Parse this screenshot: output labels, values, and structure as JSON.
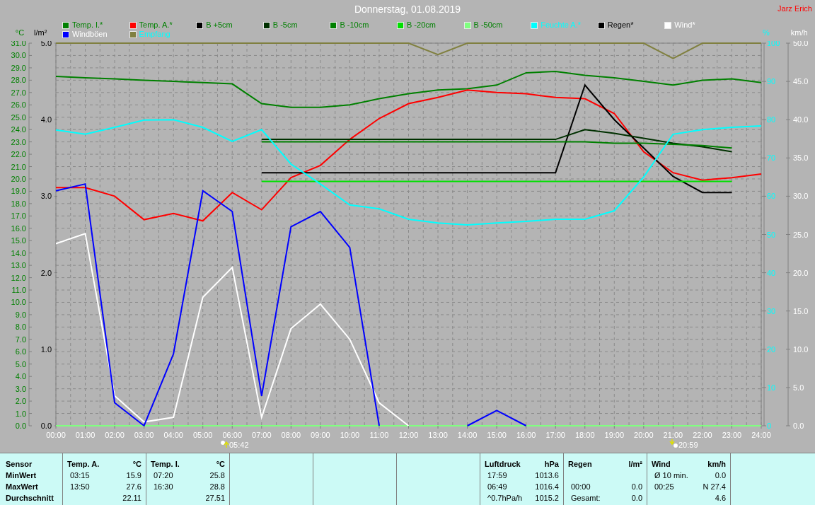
{
  "chart": {
    "author": "Jarz Erich",
    "axis_units": [
      {
        "unit": "°C",
        "color": "#008000"
      },
      {
        "unit": "l/m²",
        "color": "#000000"
      },
      {
        "unit": "%",
        "color": "#00ffff"
      },
      {
        "unit": "km/h",
        "color": "#ffffff"
      }
    ],
    "rain_ticks": [
      "5.0",
      "4.0",
      "3.0",
      "2.0",
      "1.0",
      "0.0"
    ],
    "sunrise": "05:42",
    "sunset": "20:59",
    "chart_data": {
      "type": "line",
      "title": "Donnerstag, 01.08.2019",
      "x": [
        0,
        1,
        2,
        3,
        4,
        5,
        6,
        7,
        8,
        9,
        10,
        11,
        12,
        13,
        14,
        15,
        16,
        17,
        18,
        19,
        20,
        21,
        22,
        23,
        24
      ],
      "xlim": [
        0,
        24
      ],
      "ylim": [
        0,
        31
      ],
      "grid": true,
      "y2lim": [
        0,
        50
      ],
      "y3lim": [
        0,
        100
      ],
      "xticks": [
        {
          "value": 0,
          "label": "00:00"
        },
        {
          "value": 1,
          "label": "01:00"
        },
        {
          "value": 2,
          "label": "02:00"
        },
        {
          "value": 3,
          "label": "03:00"
        },
        {
          "value": 4,
          "label": "04:00"
        },
        {
          "value": 5,
          "label": "05:00"
        },
        {
          "value": 6,
          "label": "06:00"
        },
        {
          "value": 7,
          "label": "07:00"
        },
        {
          "value": 8,
          "label": "08:00"
        },
        {
          "value": 9,
          "label": "09:00"
        },
        {
          "value": 10,
          "label": "10:00"
        },
        {
          "value": 11,
          "label": "11:00"
        },
        {
          "value": 12,
          "label": "12:00"
        },
        {
          "value": 13,
          "label": "13:00"
        },
        {
          "value": 14,
          "label": "14:00"
        },
        {
          "value": 15,
          "label": "15:00"
        },
        {
          "value": 16,
          "label": "16:00"
        },
        {
          "value": 17,
          "label": "17:00"
        },
        {
          "value": 18,
          "label": "18:00"
        },
        {
          "value": 19,
          "label": "19:00"
        },
        {
          "value": 20,
          "label": "20:00"
        },
        {
          "value": 21,
          "label": "21:00"
        },
        {
          "value": 22,
          "label": "22:00"
        },
        {
          "value": 23,
          "label": "23:00"
        },
        {
          "value": 24,
          "label": "24:00"
        }
      ],
      "yticks": [
        {
          "value": 31,
          "label": "31.0"
        },
        {
          "value": 30,
          "label": "30.0"
        },
        {
          "value": 29,
          "label": "29.0"
        },
        {
          "value": 28,
          "label": "28.0"
        },
        {
          "value": 27,
          "label": "27.0"
        },
        {
          "value": 26,
          "label": "26.0"
        },
        {
          "value": 25,
          "label": "25.0"
        },
        {
          "value": 24,
          "label": "24.0"
        },
        {
          "value": 23,
          "label": "23.0"
        },
        {
          "value": 22,
          "label": "22.0"
        },
        {
          "value": 21,
          "label": "21.0"
        },
        {
          "value": 20,
          "label": "20.0"
        },
        {
          "value": 19,
          "label": "19.0"
        },
        {
          "value": 18,
          "label": "18.0"
        },
        {
          "value": 17,
          "label": "17.0"
        },
        {
          "value": 16,
          "label": "16.0"
        },
        {
          "value": 15,
          "label": "15.0"
        },
        {
          "value": 14,
          "label": "14.0"
        },
        {
          "value": 13,
          "label": "13.0"
        },
        {
          "value": 12,
          "label": "12.0"
        },
        {
          "value": 11,
          "label": "11.0"
        },
        {
          "value": 10,
          "label": "10.0"
        },
        {
          "value": 9,
          "label": "9.0"
        },
        {
          "value": 8,
          "label": "8.0"
        },
        {
          "value": 7,
          "label": "7.0"
        },
        {
          "value": 6,
          "label": "6.0"
        },
        {
          "value": 5,
          "label": "5.0"
        },
        {
          "value": 4,
          "label": "4.0"
        },
        {
          "value": 3,
          "label": "3.0"
        },
        {
          "value": 2,
          "label": "2.0"
        },
        {
          "value": 1,
          "label": "1.0"
        },
        {
          "value": 0,
          "label": "0.0"
        }
      ],
      "y3ticks": [
        100,
        90,
        80,
        70,
        60,
        50,
        40,
        30,
        20,
        10,
        0
      ],
      "y2ticks": [
        {
          "value": 50,
          "label": "50.0"
        },
        {
          "value": 45,
          "label": "45.0"
        },
        {
          "value": 40,
          "label": "40.0"
        },
        {
          "value": 35,
          "label": "35.0"
        },
        {
          "value": 30,
          "label": "30.0"
        },
        {
          "value": 25,
          "label": "25.0"
        },
        {
          "value": 20,
          "label": "20.0"
        },
        {
          "value": 15,
          "label": "15.0"
        },
        {
          "value": 10,
          "label": "10.0"
        },
        {
          "value": 5,
          "label": "5.0"
        },
        {
          "value": 0,
          "label": "0.0"
        }
      ],
      "series": [
        {
          "name": "Temp. I.*",
          "color": "#008000",
          "values": [
            28.3,
            28.2,
            28.1,
            28.0,
            27.9,
            27.8,
            27.7,
            26.1,
            25.8,
            25.8,
            26.0,
            26.5,
            26.9,
            27.2,
            27.3,
            27.6,
            28.6,
            28.7,
            28.4,
            28.2,
            27.9,
            27.6,
            28.0,
            28.1,
            27.8
          ]
        },
        {
          "name": "Temp. A.*",
          "color": "#ff0000",
          "values": [
            19.3,
            19.3,
            18.6,
            16.7,
            17.2,
            16.6,
            18.9,
            17.5,
            20.1,
            21.1,
            23.2,
            24.9,
            26.1,
            26.6,
            27.2,
            27.0,
            26.9,
            26.6,
            26.5,
            25.3,
            22.2,
            20.5,
            19.9,
            20.1,
            20.4
          ]
        },
        {
          "name": "B +5cm",
          "color": "#000000",
          "values": [
            null,
            null,
            null,
            null,
            null,
            null,
            null,
            20.5,
            20.5,
            20.5,
            20.5,
            20.5,
            20.5,
            20.5,
            20.5,
            20.5,
            20.5,
            20.5,
            27.6,
            24.8,
            22.5,
            20.2,
            18.9,
            18.9,
            null
          ]
        },
        {
          "name": "B -5cm",
          "color": "#003000",
          "values": [
            null,
            null,
            null,
            null,
            null,
            null,
            null,
            23.2,
            23.2,
            23.2,
            23.2,
            23.2,
            23.2,
            23.2,
            23.2,
            23.2,
            23.2,
            23.2,
            24.0,
            23.7,
            23.3,
            22.9,
            22.6,
            22.2,
            null
          ]
        },
        {
          "name": "B -10cm",
          "color": "#008000",
          "values": [
            null,
            null,
            null,
            null,
            null,
            null,
            null,
            23.0,
            23.0,
            23.0,
            23.0,
            23.0,
            23.0,
            23.0,
            23.0,
            23.0,
            23.0,
            23.0,
            23.0,
            22.9,
            22.9,
            22.8,
            22.7,
            22.5,
            null
          ]
        },
        {
          "name": "B -20cm",
          "color": "#00e000",
          "values": [
            null,
            null,
            null,
            null,
            null,
            null,
            null,
            19.8,
            19.8,
            19.8,
            19.8,
            19.8,
            19.8,
            19.8,
            19.8,
            19.8,
            19.8,
            19.8,
            19.8,
            19.8,
            19.8,
            19.8,
            19.8,
            19.8,
            null
          ]
        },
        {
          "name": "B -50cm",
          "color": "#80ff80",
          "values": [
            0,
            0,
            0,
            0,
            0,
            0,
            0,
            0,
            0,
            0,
            0,
            0,
            0,
            0,
            0,
            0,
            0,
            0,
            0,
            0,
            0,
            0,
            0,
            0,
            0
          ]
        },
        {
          "name": "Feuchte A.*",
          "color": "#00ffff",
          "axis": "y3",
          "values": [
            77.3,
            76.2,
            78,
            79.9,
            80,
            78,
            74.3,
            77.4,
            68.4,
            63.2,
            57.7,
            56.7,
            54,
            53,
            52.5,
            53,
            53.4,
            54,
            54,
            56.2,
            65,
            76.2,
            77.4,
            78,
            78.4
          ]
        },
        {
          "name": "Regen*",
          "color": "#000000",
          "values": [
            null,
            null,
            null,
            null,
            null,
            null,
            null,
            null,
            null,
            null,
            null,
            null,
            null,
            null,
            null,
            null,
            null,
            null,
            null,
            null,
            null,
            null,
            null,
            null,
            null
          ]
        },
        {
          "name": "Wind*",
          "color": "#ffffff",
          "axis": "y2",
          "values": [
            23.8,
            25.1,
            3.9,
            0.5,
            1.1,
            16.8,
            20.7,
            1.1,
            12.7,
            15.9,
            11.3,
            3,
            0,
            null,
            null,
            null,
            null,
            null,
            null,
            null,
            null,
            null,
            null,
            null,
            null
          ]
        },
        {
          "name": "Windböen",
          "color": "#0000ff",
          "axis": "y2",
          "values": [
            30.7,
            31.6,
            3,
            0,
            9.4,
            30.7,
            28,
            3.9,
            26,
            28,
            23.3,
            0,
            null,
            null,
            0,
            2,
            0,
            null,
            null,
            null,
            null,
            null,
            null,
            null,
            null
          ]
        },
        {
          "name": "Empfang",
          "color": "#808040",
          "axis": "y3",
          "values": [
            100,
            100,
            100,
            100,
            100,
            100,
            100,
            100,
            100,
            100,
            100,
            100,
            100,
            97,
            100,
            100,
            100,
            100,
            100,
            100,
            100,
            96,
            100,
            100,
            100
          ]
        }
      ]
    }
  },
  "summary_table": {
    "panels": [
      {
        "kind": "labels",
        "header": "Sensor",
        "rows": [
          "MinWert",
          "MaxWert",
          "Durchschnitt"
        ]
      },
      {
        "kind": "values",
        "title": "Temp. A.",
        "unit": "°C",
        "rows": [
          {
            "time": "03:15",
            "value": "15.9"
          },
          {
            "time": "13:50",
            "value": "27.6"
          },
          {
            "value": "22.11"
          }
        ]
      },
      {
        "kind": "values",
        "title": "Temp. I.",
        "unit": "°C",
        "rows": [
          {
            "time": "07:20",
            "value": "25.8"
          },
          {
            "time": "16:30",
            "value": "28.8"
          },
          {
            "value": "27.51"
          }
        ]
      },
      {
        "kind": "empty"
      },
      {
        "kind": "empty"
      },
      {
        "kind": "empty"
      },
      {
        "kind": "values",
        "title": "Luftdruck",
        "unit": "hPa",
        "rows": [
          {
            "time": "17:59",
            "value": "1013.6"
          },
          {
            "time": "06:49",
            "value": "1016.4"
          },
          {
            "time": "^0.7hPa/h",
            "value": "1015.2"
          }
        ]
      },
      {
        "kind": "values",
        "title": "Regen",
        "unit": "l/m²",
        "rows": [
          {},
          {
            "time": "00:00",
            "value": "0.0"
          },
          {
            "time": "Gesamt:",
            "value": "0.0"
          }
        ]
      },
      {
        "kind": "values",
        "title": "Wind",
        "unit": "km/h",
        "rows": [
          {
            "time": "Ø 10 min.",
            "value": "0.0"
          },
          {
            "time": "00:25",
            "value": "N 27.4"
          },
          {
            "value": "4.6"
          }
        ]
      },
      {
        "kind": "rest"
      }
    ]
  }
}
